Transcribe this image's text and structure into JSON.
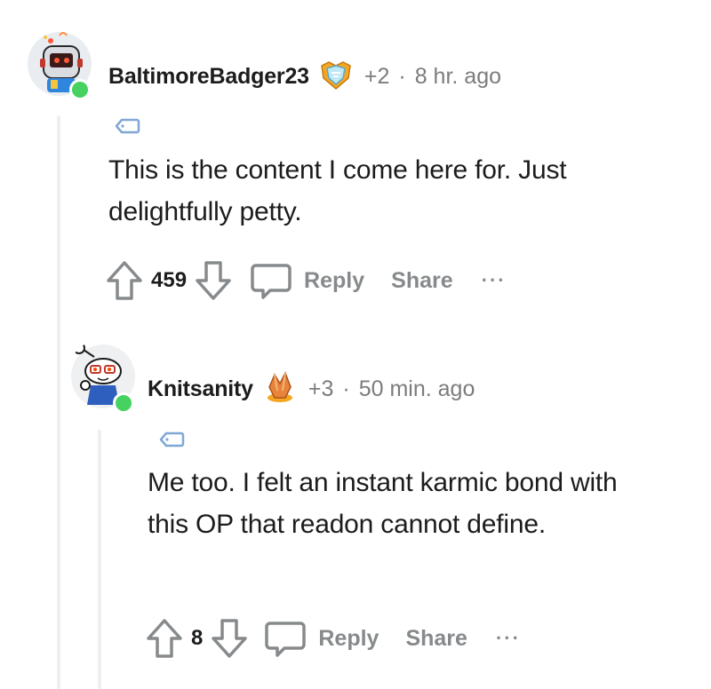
{
  "comments": [
    {
      "username": "BaltimoreBadger23",
      "award_icon": "shield-award-icon",
      "karma": "+2",
      "separator": "·",
      "time": "8 hr. ago",
      "body": "This is the content I come here for. Just delightfully petty.",
      "votes": "459",
      "reply_label": "Reply",
      "share_label": "Share",
      "more_label": "···"
    },
    {
      "username": "Knitsanity",
      "award_icon": "crystal-award-icon",
      "karma": "+3",
      "separator": "·",
      "time": "50 min. ago",
      "body": "Me too. I felt an instant karmic bond with this OP that readon cannot define.",
      "votes": "8",
      "reply_label": "Reply",
      "share_label": "Share",
      "more_label": "···"
    }
  ],
  "colors": {
    "online": "#46d160",
    "muted": "#878a8c",
    "thread_line": "#edeff1",
    "flair": "#7fa7d6"
  }
}
